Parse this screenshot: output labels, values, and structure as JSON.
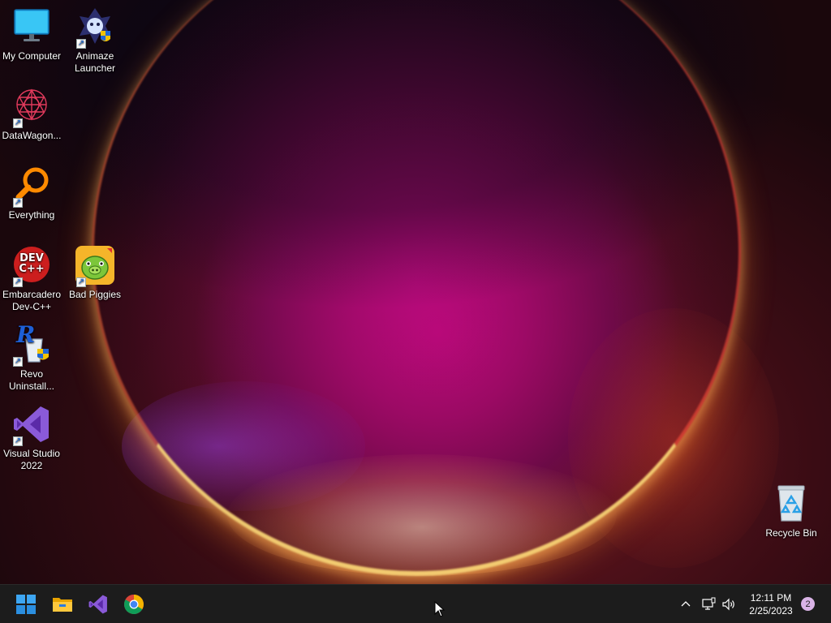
{
  "desktop": {
    "icons": [
      {
        "label": "My Computer"
      },
      {
        "label": "Animaze Launcher"
      },
      {
        "label": "DataWagon..."
      },
      {
        "label": "Everything"
      },
      {
        "label": "Embarcadero Dev-C++"
      },
      {
        "label": "Bad Piggies"
      },
      {
        "label": "Revo Uninstall..."
      },
      {
        "label": "Visual Studio 2022"
      },
      {
        "label": "Recycle Bin"
      }
    ],
    "icon_badges": {
      "devcpp": "DEV C++",
      "revo": "R"
    }
  },
  "taskbar": {
    "pinned": [
      {
        "icon": "windows-start-icon"
      },
      {
        "icon": "file-explorer-icon"
      },
      {
        "icon": "visual-studio-icon"
      },
      {
        "icon": "chrome-icon"
      }
    ],
    "tray": {
      "time": "12:11 PM",
      "date": "2/25/2023",
      "notification_count": "2"
    }
  },
  "colors": {
    "taskbar": "#1c1c1c",
    "accent": "#0078d4",
    "wallpaper_magenta": "#b0086e"
  }
}
